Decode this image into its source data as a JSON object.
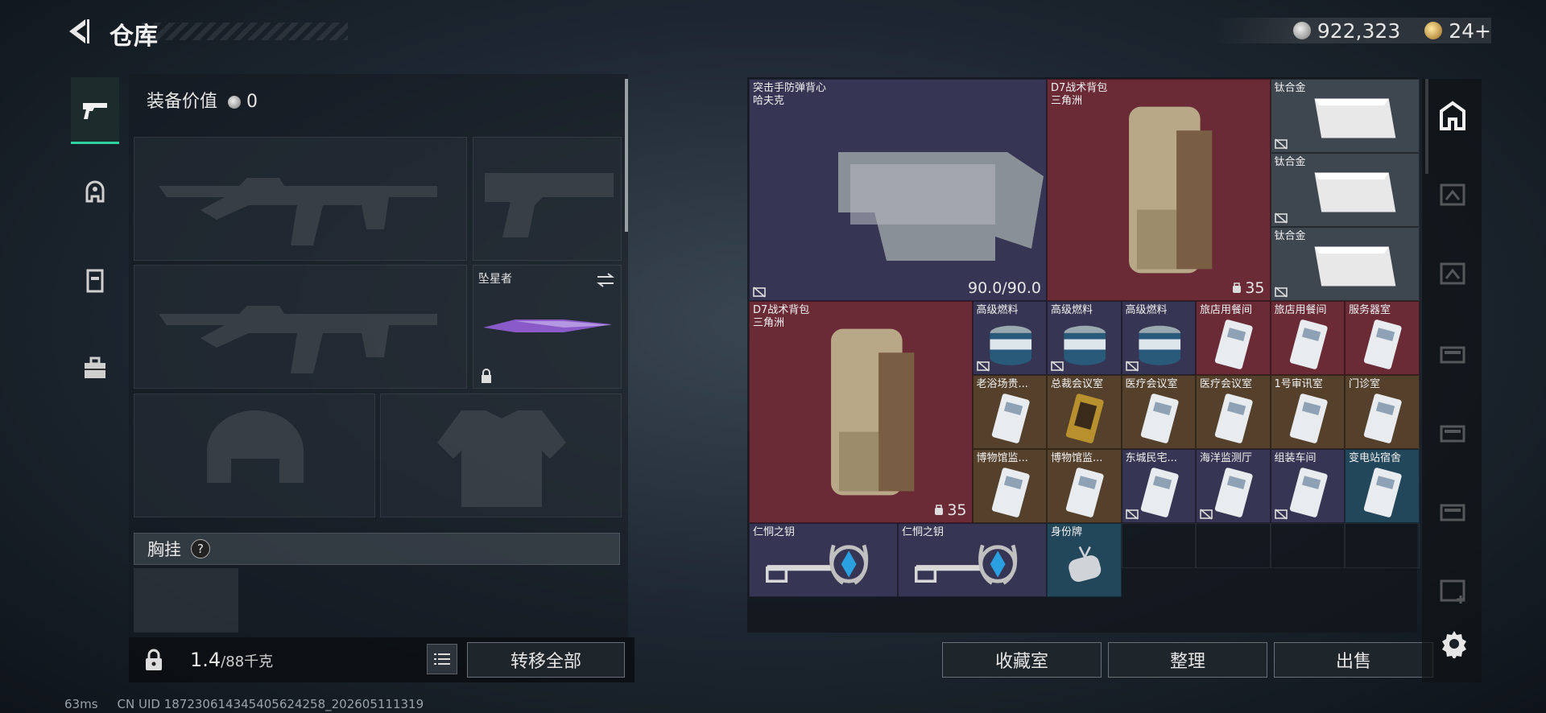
{
  "header": {
    "title": "仓库",
    "currency_amount": "922,323",
    "tokens": "24+"
  },
  "equipment": {
    "value_label": "装备价值",
    "value": "0",
    "melee_name": "坠星者",
    "chest_label": "胸挂",
    "help_symbol": "?",
    "weight_value": "1.4",
    "weight_max": "/88千克",
    "transfer_all": "转移全部"
  },
  "stash": {
    "items": [
      {
        "name": "突击手防弹背心",
        "sub": "哈夫克",
        "durability": "90.0/90.0"
      },
      {
        "name": "D7战术背包",
        "sub": "三角洲",
        "count": "35"
      },
      {
        "name": "钛合金"
      },
      {
        "name": "钛合金"
      },
      {
        "name": "钛合金"
      },
      {
        "name": "D7战术背包",
        "sub": "三角洲",
        "count": "35"
      },
      {
        "name": "高级燃料"
      },
      {
        "name": "高级燃料"
      },
      {
        "name": "高级燃料"
      },
      {
        "name": "旅店用餐间"
      },
      {
        "name": "旅店用餐间"
      },
      {
        "name": "服务器室"
      },
      {
        "name": "老浴场贵..."
      },
      {
        "name": "总裁会议室"
      },
      {
        "name": "医疗会议室"
      },
      {
        "name": "医疗会议室"
      },
      {
        "name": "1号审讯室"
      },
      {
        "name": "门诊室"
      },
      {
        "name": "博物馆监..."
      },
      {
        "name": "博物馆监..."
      },
      {
        "name": "东城民宅..."
      },
      {
        "name": "海洋监测厅"
      },
      {
        "name": "组装车间"
      },
      {
        "name": "变电站宿舍"
      },
      {
        "name": "仁恫之钥"
      },
      {
        "name": "仁恫之钥"
      },
      {
        "name": "身份牌"
      }
    ],
    "buttons": {
      "collection": "收藏室",
      "sort": "整理",
      "sell": "出售"
    }
  },
  "status_bar": {
    "ping": "63ms",
    "uid": "CN UID 18723061434540562425​8_202605111319"
  },
  "colors": {
    "accent": "#2ed1a0",
    "item_red": "#6a2b36",
    "item_purple": "#363553",
    "item_brown": "#54402b",
    "item_blue": "#22465a"
  }
}
